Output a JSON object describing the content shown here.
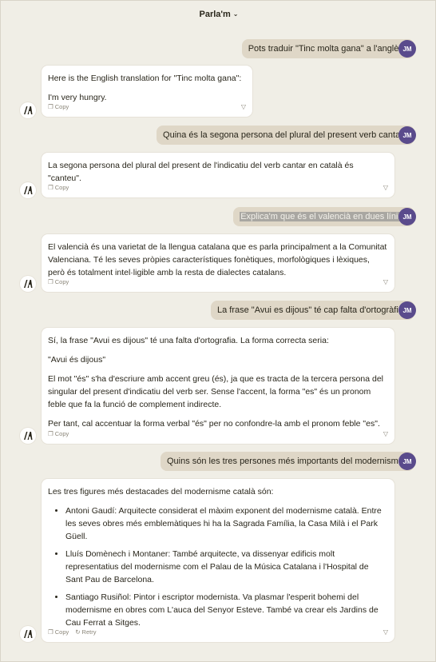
{
  "header": {
    "title": "Parla'm",
    "chevron": "chevron-down-icon"
  },
  "actions": {
    "copy": "Copy",
    "retry": "Retry"
  },
  "user_initials": "JM",
  "messages": [
    {
      "user": "Pots traduir \"Tinc molta gana\" a l'anglès?",
      "bot": [
        "Here is the English translation for \"Tinc molta gana\":",
        "I'm very hungry."
      ]
    },
    {
      "user": "Quina és la segona persona del plural del present verb cantar?",
      "bot": [
        "La segona persona del plural del present de l'indicatiu del verb cantar en català és \"canteu\"."
      ]
    },
    {
      "user": "Explica'm que és el valencià en dues línies",
      "bot": [
        "El valencià és una varietat de la llengua catalana que es parla principalment a la Comunitat Valenciana. Té les seves pròpies característiques fonètiques, morfològiques i lèxiques, però és totalment intel·ligible amb la resta de dialectes catalans."
      ]
    },
    {
      "user": "La frase \"Avui es dijous\" té cap falta d'ortogràfia?",
      "bot": [
        "Sí, la frase \"Avui es dijous\" té una falta d'ortografia. La forma correcta seria:",
        "\"Avui és dijous\"",
        "El mot \"és\" s'ha d'escriure amb accent greu (és), ja que es tracta de la tercera persona del singular del present d'indicatiu del verb ser. Sense l'accent, la forma \"es\" és un pronom feble que fa la funció de complement indirecte.",
        "Per tant, cal accentuar la forma verbal \"és\" per no confondre-la amb el pronom feble \"es\"."
      ]
    },
    {
      "user": "Quins són les tres persones més importants del modernisme?",
      "bot_intro": "Les tres figures més destacades del modernisme català són:",
      "bot_list": [
        "Antoni Gaudí: Arquitecte considerat el màxim exponent del modernisme català. Entre les seves obres més emblemàtiques hi ha la Sagrada Família, la Casa Milà i el Park Güell.",
        "Lluís Domènech i Montaner: També arquitecte, va dissenyar edificis molt representatius del modernisme com el Palau de la Música Catalana i l'Hospital de Sant Pau de Barcelona.",
        "Santiago Rusiñol: Pintor i escriptor modernista. Va plasmar l'esperit bohemi del modernisme en obres com L'auca del Senyor Esteve. També va crear els Jardins de Cau Ferrat a Sitges."
      ]
    }
  ]
}
